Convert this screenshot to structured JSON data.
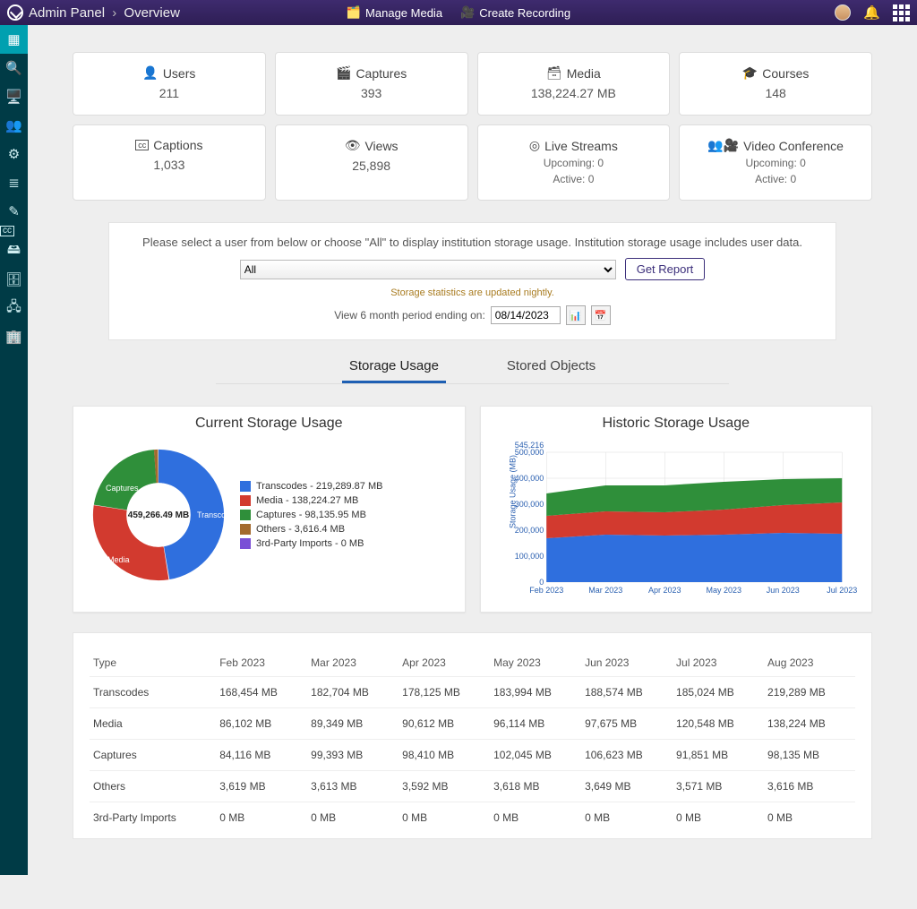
{
  "header": {
    "breadcrumb1": "Admin Panel",
    "breadcrumb2": "Overview",
    "manage_media": "Manage Media",
    "create_recording": "Create Recording"
  },
  "cards": {
    "users": {
      "label": "Users",
      "value": "211"
    },
    "captures": {
      "label": "Captures",
      "value": "393"
    },
    "media": {
      "label": "Media",
      "value": "138,224.27 MB"
    },
    "courses": {
      "label": "Courses",
      "value": "148"
    },
    "captions": {
      "label": "Captions",
      "value": "1,033"
    },
    "views": {
      "label": "Views",
      "value": "25,898"
    },
    "live": {
      "label": "Live Streams",
      "upcoming": "Upcoming: 0",
      "active": "Active: 0"
    },
    "vc": {
      "label": "Video Conference",
      "upcoming": "Upcoming: 0",
      "active": "Active: 0"
    }
  },
  "filter": {
    "help": "Please select a user from below or choose \"All\" to display institution storage usage. Institution storage usage includes user data.",
    "option_all": "All",
    "get_report": "Get Report",
    "note": "Storage statistics are updated nightly.",
    "period_label": "View 6 month period ending on:",
    "date": "08/14/2023"
  },
  "tabs": {
    "storage": "Storage Usage",
    "objects": "Stored Objects"
  },
  "donut": {
    "title": "Current Storage Usage",
    "center": "459,266.49 MB",
    "seg_labels": {
      "transcodes": "Transcodes",
      "media": "Media",
      "captures": "Captures"
    },
    "legend": [
      {
        "color": "#2f6fde",
        "label": "Transcodes - 219,289.87 MB"
      },
      {
        "color": "#d23a2f",
        "label": "Media - 138,224.27 MB"
      },
      {
        "color": "#2f8f3a",
        "label": "Captures - 98,135.95 MB"
      },
      {
        "color": "#a36a2e",
        "label": "Others - 3,616.4 MB"
      },
      {
        "color": "#7a4fd6",
        "label": "3rd-Party Imports - 0 MB"
      }
    ]
  },
  "area": {
    "title": "Historic Storage Usage",
    "ymax_label": "545,216",
    "yticks": [
      "0",
      "100,000",
      "200,000",
      "300,000",
      "400,000",
      "500,000"
    ],
    "xticks": [
      "Feb 2023",
      "Mar 2023",
      "Apr 2023",
      "May 2023",
      "Jun 2023",
      "Jul 2023"
    ],
    "ylabel": "Storage Usage (MB)"
  },
  "table": {
    "headers": [
      "Type",
      "Feb 2023",
      "Mar 2023",
      "Apr 2023",
      "May 2023",
      "Jun 2023",
      "Jul 2023",
      "Aug 2023"
    ],
    "rows": [
      [
        "Transcodes",
        "168,454 MB",
        "182,704 MB",
        "178,125 MB",
        "183,994 MB",
        "188,574 MB",
        "185,024 MB",
        "219,289 MB"
      ],
      [
        "Media",
        "86,102 MB",
        "89,349 MB",
        "90,612 MB",
        "96,114 MB",
        "97,675 MB",
        "120,548 MB",
        "138,224 MB"
      ],
      [
        "Captures",
        "84,116 MB",
        "99,393 MB",
        "98,410 MB",
        "102,045 MB",
        "106,623 MB",
        "91,851 MB",
        "98,135 MB"
      ],
      [
        "Others",
        "3,619 MB",
        "3,613 MB",
        "3,592 MB",
        "3,618 MB",
        "3,649 MB",
        "3,571 MB",
        "3,616 MB"
      ],
      [
        "3rd-Party Imports",
        "0 MB",
        "0 MB",
        "0 MB",
        "0 MB",
        "0 MB",
        "0 MB",
        "0 MB"
      ]
    ]
  },
  "chart_data": [
    {
      "type": "pie",
      "title": "Current Storage Usage",
      "total_mb": 459266.49,
      "series": [
        {
          "name": "Transcodes",
          "value": 219289.87,
          "color": "#2f6fde"
        },
        {
          "name": "Media",
          "value": 138224.27,
          "color": "#d23a2f"
        },
        {
          "name": "Captures",
          "value": 98135.95,
          "color": "#2f8f3a"
        },
        {
          "name": "Others",
          "value": 3616.4,
          "color": "#a36a2e"
        },
        {
          "name": "3rd-Party Imports",
          "value": 0,
          "color": "#7a4fd6"
        }
      ]
    },
    {
      "type": "area",
      "title": "Historic Storage Usage",
      "xlabel": "",
      "ylabel": "Storage Usage (MB)",
      "ylim": [
        0,
        545216
      ],
      "categories": [
        "Feb 2023",
        "Mar 2023",
        "Apr 2023",
        "May 2023",
        "Jun 2023",
        "Jul 2023",
        "Aug 2023"
      ],
      "series": [
        {
          "name": "Transcodes",
          "color": "#2f6fde",
          "values": [
            168454,
            182704,
            178125,
            183994,
            188574,
            185024,
            219289
          ]
        },
        {
          "name": "Media",
          "color": "#d23a2f",
          "values": [
            86102,
            89349,
            90612,
            96114,
            97675,
            120548,
            138224
          ]
        },
        {
          "name": "Captures",
          "color": "#2f8f3a",
          "values": [
            84116,
            99393,
            98410,
            102045,
            106623,
            91851,
            98135
          ]
        },
        {
          "name": "Others",
          "color": "#a36a2e",
          "values": [
            3619,
            3613,
            3592,
            3618,
            3649,
            3571,
            3616
          ]
        },
        {
          "name": "3rd-Party Imports",
          "color": "#7a4fd6",
          "values": [
            0,
            0,
            0,
            0,
            0,
            0,
            0
          ]
        }
      ]
    }
  ]
}
